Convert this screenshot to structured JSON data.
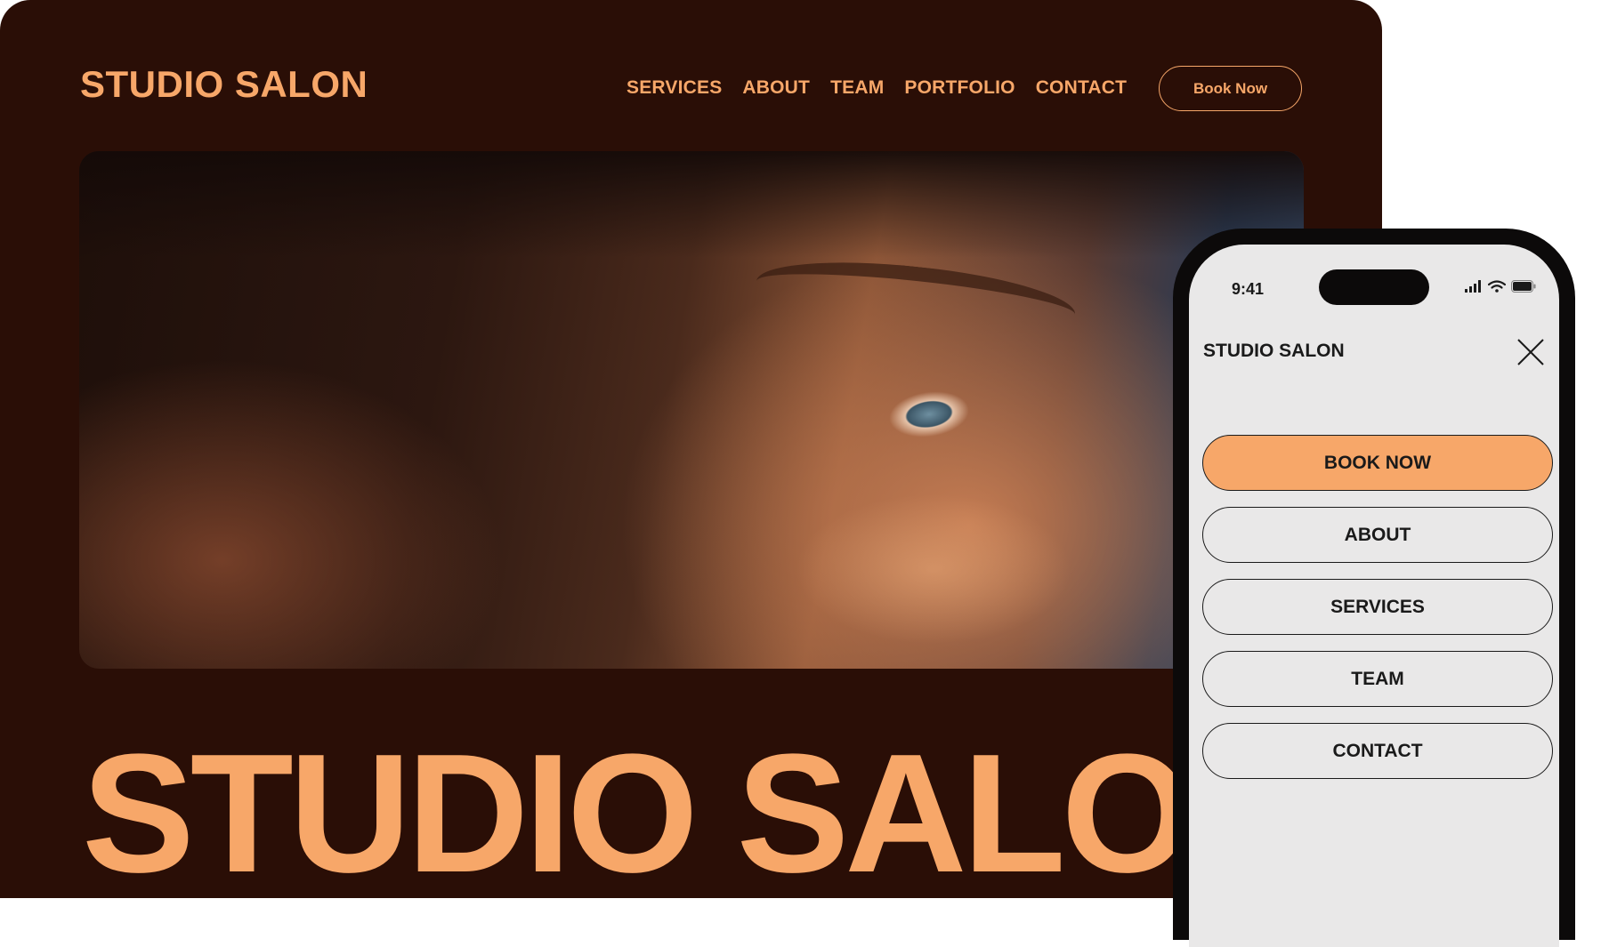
{
  "colors": {
    "background_dark": "#2a0e06",
    "accent": "#f7a769",
    "phone_screen": "#e9e8e8",
    "phone_text": "#1a1a1a"
  },
  "desktop": {
    "logo": "STUDIO SALON",
    "nav": [
      "SERVICES",
      "ABOUT",
      "TEAM",
      "PORTFOLIO",
      "CONTACT"
    ],
    "book_button": "Book Now",
    "hero_image": "close-up portrait photo of a woman's eye and freckled cheek",
    "big_title": "STUDIO SALO"
  },
  "phone": {
    "status": {
      "time": "9:41",
      "icons": [
        "signal-icon",
        "wifi-icon",
        "battery-icon"
      ]
    },
    "logo": "STUDIO SALON",
    "close_icon": "close-icon",
    "menu": [
      "BOOK NOW",
      "ABOUT",
      "SERVICES",
      "TEAM",
      "CONTACT"
    ]
  }
}
